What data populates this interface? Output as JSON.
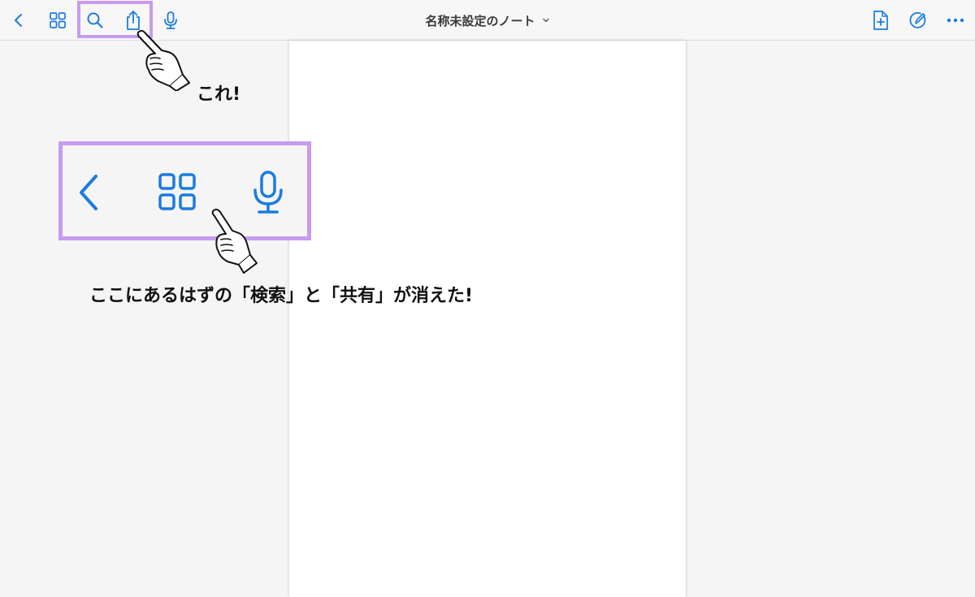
{
  "toolbar": {
    "document_title": "名称未設定のノート",
    "icons": {
      "back": "chevron-left-icon",
      "thumbnails": "grid-icon",
      "search": "search-icon",
      "share": "share-icon",
      "microphone": "microphone-icon",
      "title_dropdown": "chevron-down-icon",
      "new_page": "add-page-icon",
      "pen": "pencil-circle-icon",
      "more": "more-icon"
    }
  },
  "zoomed_toolbar": {
    "icons": [
      "chevron-left-icon",
      "grid-icon",
      "microphone-icon"
    ]
  },
  "annotations": {
    "this_label": "これ!",
    "missing_label": "ここにあるはずの「検索」と「共有」が消えた!"
  },
  "colors": {
    "accent_blue": "#1a7be0",
    "highlight_purple": "#c79bf0",
    "toolbar_bg": "#f7f7f7",
    "background": "#f5f5f5",
    "page": "#ffffff"
  }
}
